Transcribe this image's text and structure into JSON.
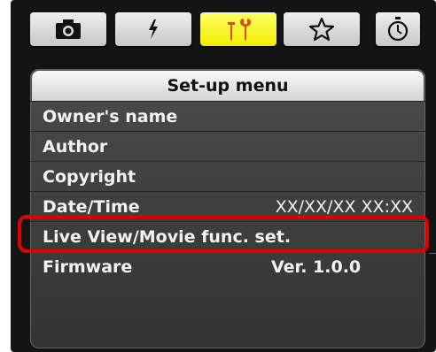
{
  "tabs": [
    {
      "icon": "camera-icon"
    },
    {
      "icon": "flash-icon"
    },
    {
      "icon": "setup-tools-icon",
      "active": true
    },
    {
      "icon": "star-icon"
    },
    {
      "icon": "timer-icon"
    }
  ],
  "menu": {
    "title": "Set-up menu",
    "items": [
      {
        "label": "Owner's name",
        "value": ""
      },
      {
        "label": "Author",
        "value": ""
      },
      {
        "label": "Copyright",
        "value": ""
      },
      {
        "label": "Date/Time",
        "value": "XX/XX/XX XX:XX"
      },
      {
        "label": "Live View/Movie func. set.",
        "value": ""
      },
      {
        "label": "Firmware",
        "value": "Ver. 1.0.0"
      }
    ]
  },
  "colors": {
    "highlight": "#e00000",
    "active_tab": "#ffff33"
  }
}
